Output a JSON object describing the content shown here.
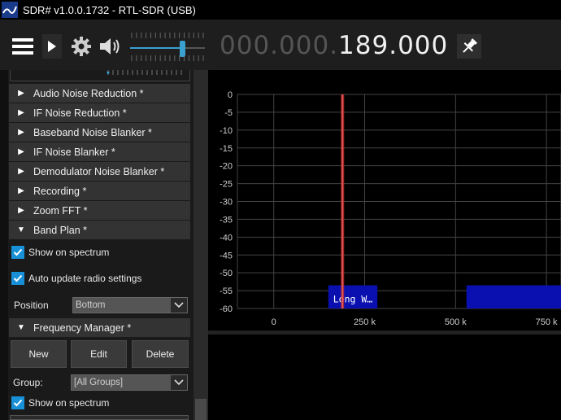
{
  "titlebar": {
    "title": "SDR# v1.0.0.1732 - RTL-SDR (USB)"
  },
  "toolbar": {
    "icons": [
      "menu-icon",
      "play-icon",
      "gear-icon",
      "speaker-icon",
      "pin-icon"
    ],
    "volume_level": 0.72,
    "frequency_dim": "000.000.",
    "frequency_main": "189.000"
  },
  "sections": [
    {
      "label": "Audio Noise Reduction *",
      "expanded": false
    },
    {
      "label": "IF Noise Reduction *",
      "expanded": false
    },
    {
      "label": "Baseband Noise Blanker *",
      "expanded": false
    },
    {
      "label": "IF Noise Blanker *",
      "expanded": false
    },
    {
      "label": "Demodulator Noise Blanker *",
      "expanded": false
    },
    {
      "label": "Recording *",
      "expanded": false
    },
    {
      "label": "Zoom FFT *",
      "expanded": false
    },
    {
      "label": "Band Plan *",
      "expanded": true
    },
    {
      "label": "Frequency Manager *",
      "expanded": true
    }
  ],
  "band_plan": {
    "show_on_spectrum": "Show on spectrum",
    "auto_update": "Auto update radio settings",
    "position_label": "Position",
    "position_value": "Bottom"
  },
  "frequency_manager": {
    "new_label": "New",
    "edit_label": "Edit",
    "delete_label": "Delete",
    "group_label": "Group:",
    "group_value": "[All Groups]",
    "show_on_spectrum": "Show on spectrum"
  },
  "chart_data": {
    "type": "line",
    "title": "",
    "xlabel": "",
    "ylabel": "",
    "y_ticks": [
      "0",
      "-5",
      "-10",
      "-15",
      "-20",
      "-25",
      "-30",
      "-35",
      "-40",
      "-45",
      "-50",
      "-55",
      "-60"
    ],
    "ylim": [
      -60,
      0
    ],
    "x_ticks": [
      "0",
      "250 k",
      "500 k",
      "750 k"
    ],
    "x_tick_values": [
      0,
      250000,
      500000,
      750000
    ],
    "xlim": [
      -100000,
      790000
    ],
    "grid": true,
    "marker_frequency": 189000,
    "band_labels": [
      {
        "label": "Long W…",
        "start": 150000,
        "end": 285000
      },
      {
        "label": "",
        "start": 530000,
        "end": 790000
      }
    ],
    "colors": {
      "grid": "#444444",
      "marker": "#c03030",
      "band": "#0a10b0",
      "text": "#cfcfcf"
    }
  }
}
